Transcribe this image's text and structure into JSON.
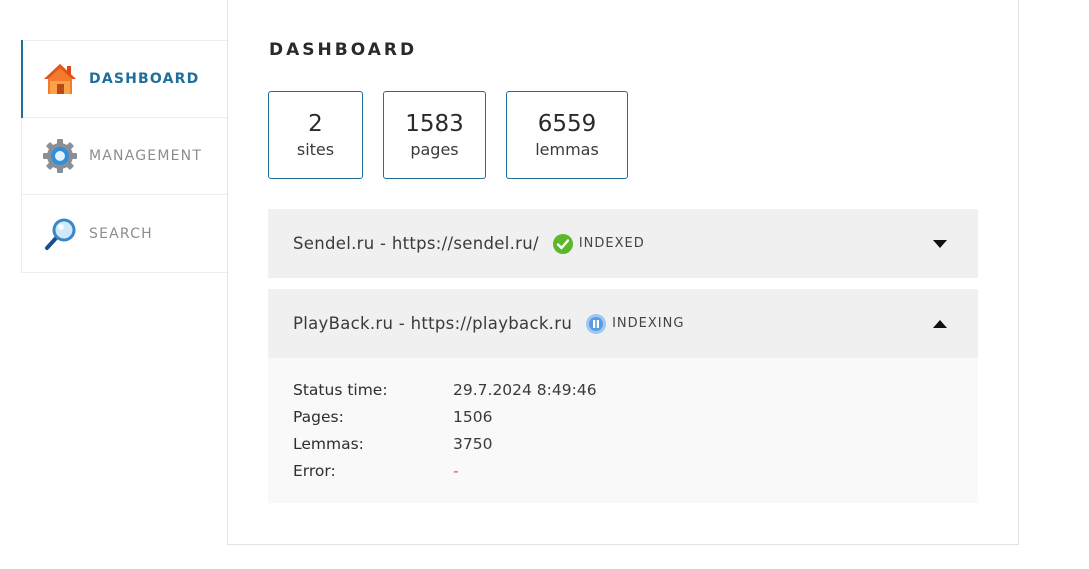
{
  "sidebar": {
    "items": [
      {
        "label": "DASHBOARD",
        "icon": "home-icon",
        "active": true
      },
      {
        "label": "MANAGEMENT",
        "icon": "gear-icon",
        "active": false
      },
      {
        "label": "SEARCH",
        "icon": "magnifier-icon",
        "active": false
      }
    ]
  },
  "main": {
    "title": "DASHBOARD",
    "stats": [
      {
        "value": "2",
        "label": "sites"
      },
      {
        "value": "1583",
        "label": "pages"
      },
      {
        "value": "6559",
        "label": "lemmas"
      }
    ],
    "sites": [
      {
        "name": "Sendel.ru - https://sendel.ru/",
        "status": "INDEXED",
        "status_icon": "check-icon",
        "expanded": false
      },
      {
        "name": "PlayBack.ru - https://playback.ru",
        "status": "INDEXING",
        "status_icon": "pause-icon",
        "expanded": true,
        "details": [
          {
            "label": "Status time:",
            "value": "29.7.2024 8:49:46"
          },
          {
            "label": "Pages:",
            "value": "1506"
          },
          {
            "label": "Lemmas:",
            "value": "3750"
          },
          {
            "label": "Error:",
            "value": "-"
          }
        ]
      }
    ]
  },
  "colors": {
    "accent": "#1f6f9a",
    "indexed": "#5cb72a",
    "indexing": "#5a9be0",
    "error": "#d45555"
  }
}
